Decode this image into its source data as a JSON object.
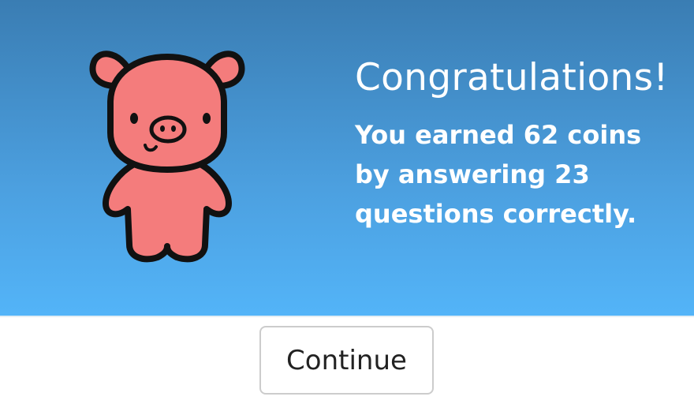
{
  "reward_screen": {
    "title": "Congratulations!",
    "message": "You earned 62 coins by answering 23 questions correctly.",
    "mascot_icon": "pig-icon",
    "pig_color": "#f47c7c",
    "banner_color_top": "#3a7db3",
    "banner_color_bottom": "#53b4f8"
  },
  "actions": {
    "continue_label": "Continue"
  }
}
